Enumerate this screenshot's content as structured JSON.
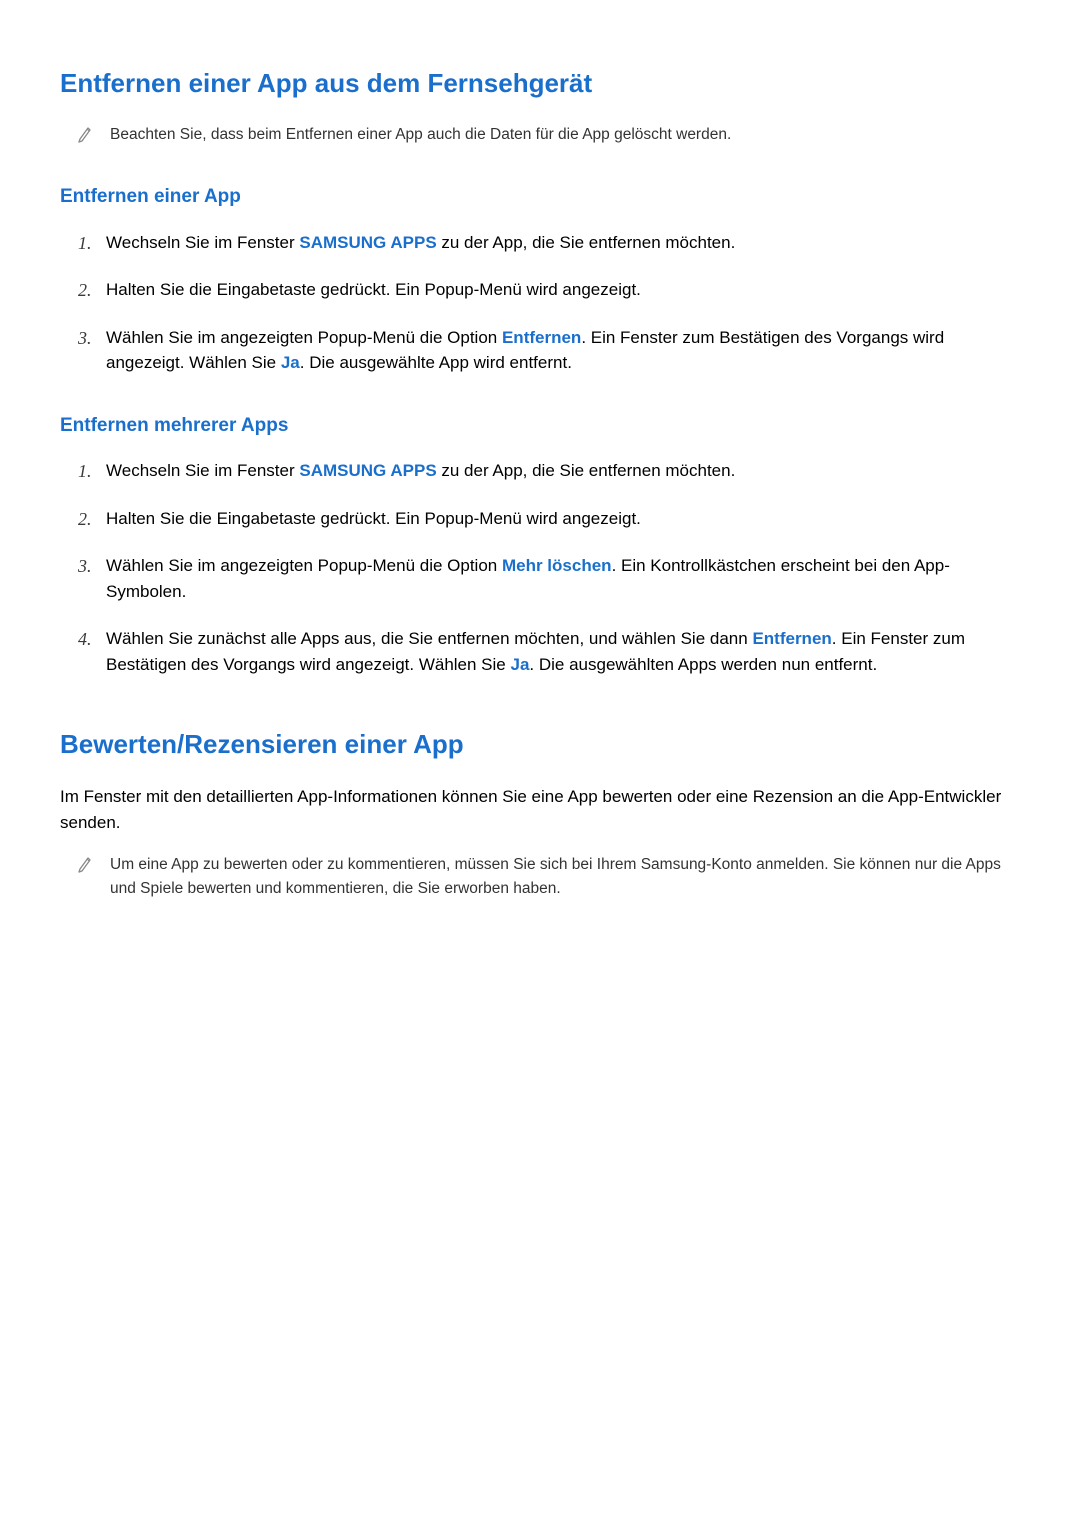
{
  "section1": {
    "title": "Entfernen einer App aus dem Fernsehgerät",
    "note": "Beachten Sie, dass beim Entfernen einer App auch die Daten für die App gelöscht werden.",
    "sub1": {
      "title": "Entfernen einer App",
      "items": [
        {
          "pre": "Wechseln Sie im Fenster ",
          "bold": "SAMSUNG APPS",
          "post": " zu der App, die Sie entfernen möchten."
        },
        {
          "full": "Halten Sie die Eingabetaste gedrückt. Ein Popup-Menü wird angezeigt."
        },
        {
          "pre": "Wählen Sie im angezeigten Popup-Menü die Option ",
          "bold1": "Entfernen",
          "mid": ". Ein Fenster zum Bestätigen des Vorgangs wird angezeigt. Wählen Sie ",
          "bold2": "Ja",
          "post": ". Die ausgewählte App wird entfernt."
        }
      ]
    },
    "sub2": {
      "title": "Entfernen mehrerer Apps",
      "items": [
        {
          "pre": "Wechseln Sie im Fenster ",
          "bold": "SAMSUNG APPS",
          "post": " zu der App, die Sie entfernen möchten."
        },
        {
          "full": "Halten Sie die Eingabetaste gedrückt. Ein Popup-Menü wird angezeigt."
        },
        {
          "pre": "Wählen Sie im angezeigten Popup-Menü die Option ",
          "bold1": "Mehr löschen",
          "post": ". Ein Kontrollkästchen erscheint bei den App-Symbolen."
        },
        {
          "pre": "Wählen Sie zunächst alle Apps aus, die Sie entfernen möchten, und wählen Sie dann ",
          "bold1": "Entfernen",
          "mid": ". Ein Fenster zum Bestätigen des Vorgangs wird angezeigt. Wählen Sie ",
          "bold2": "Ja",
          "post": ". Die ausgewählten Apps werden nun entfernt."
        }
      ]
    }
  },
  "section2": {
    "title": "Bewerten/Rezensieren einer App",
    "intro": "Im Fenster mit den detaillierten App-Informationen können Sie eine App bewerten oder eine Rezension an die App-Entwickler senden.",
    "note": "Um eine App zu bewerten oder zu kommentieren, müssen Sie sich bei Ihrem Samsung-Konto anmelden. Sie können nur die Apps und Spiele bewerten und kommentieren, die Sie erworben haben."
  }
}
